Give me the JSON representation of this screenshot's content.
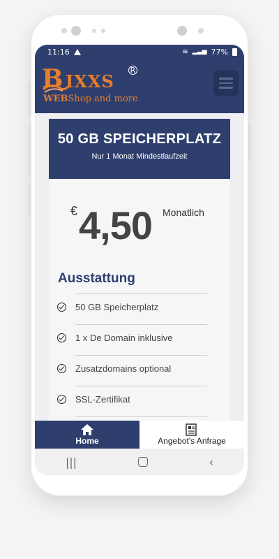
{
  "status_bar": {
    "time": "11:16",
    "battery": "77%"
  },
  "logo": {
    "letters_big": "B",
    "letters": "IXXS",
    "registered": "R",
    "tagline_bold": "WEB",
    "tagline_rest": "Shop and more"
  },
  "plan": {
    "title": "50 GB SPEICHERPLATZ",
    "subtitle": "Nur 1 Monat Mindestlaufzeit",
    "currency": "€",
    "price": "4,50",
    "period": "Monatlich",
    "features_title": "Ausstattung",
    "features": [
      "50 GB Speicherplatz",
      "1 x De Domain inklusive",
      "Zusatzdomains optional",
      "SSL-Zertifikat"
    ]
  },
  "bottom_nav": {
    "home_label": "Home",
    "offer_label": "Angebot's Anfrage"
  },
  "colors": {
    "primary": "#2e3f6e",
    "accent": "#e87d2b"
  }
}
